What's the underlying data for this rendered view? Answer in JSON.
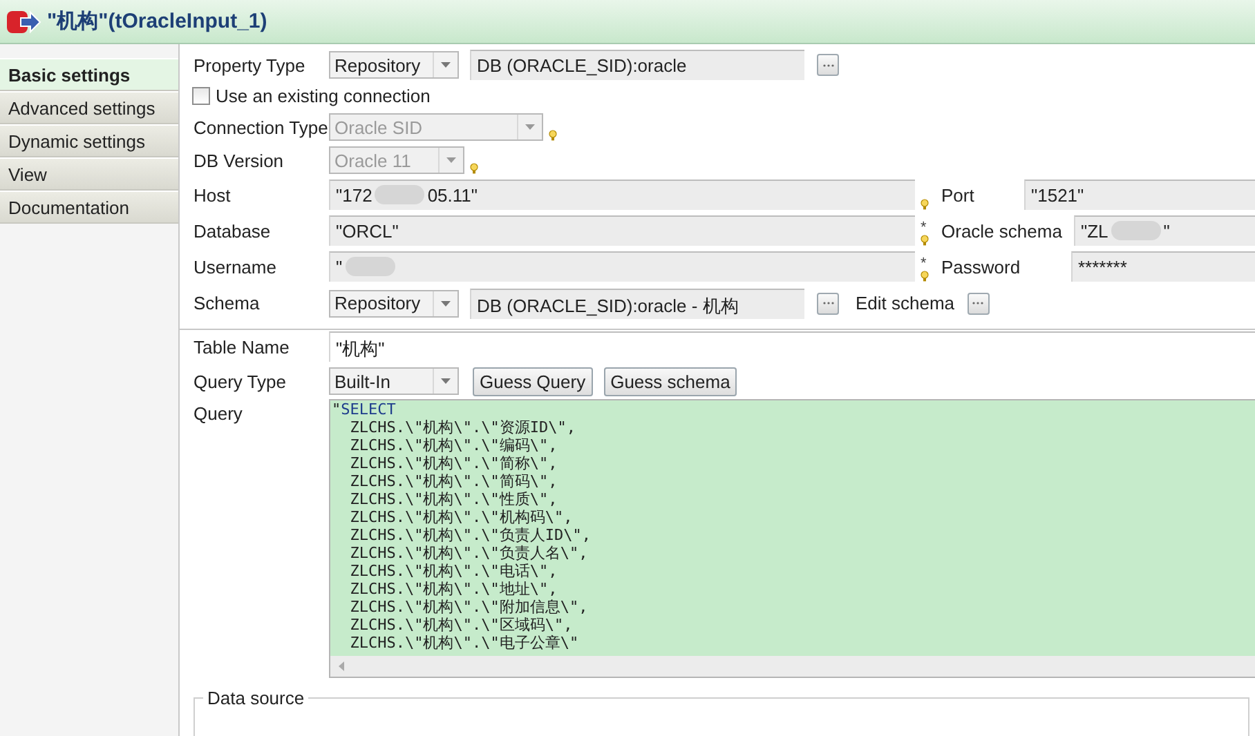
{
  "title": "\"机构\"(tOracleInput_1)",
  "sidebar": {
    "items": [
      {
        "label": "Basic settings",
        "selected": true
      },
      {
        "label": "Advanced settings",
        "selected": false
      },
      {
        "label": "Dynamic settings",
        "selected": false
      },
      {
        "label": "View",
        "selected": false
      },
      {
        "label": "Documentation",
        "selected": false
      }
    ]
  },
  "form": {
    "property_type": {
      "label": "Property Type",
      "value": "Repository",
      "repository": "DB (ORACLE_SID):oracle"
    },
    "use_existing_connection": {
      "label": "Use an existing connection",
      "checked": false
    },
    "connection_type": {
      "label": "Connection Type",
      "value": "Oracle SID",
      "disabled": true,
      "hint": true
    },
    "db_version": {
      "label": "DB Version",
      "value": "Oracle 11",
      "disabled": true,
      "hint": true
    },
    "host": {
      "label": "Host",
      "value_start": "\"172",
      "value_end": "05.11\"",
      "hint": true
    },
    "port": {
      "label": "Port",
      "value": "\"1521\""
    },
    "database": {
      "label": "Database",
      "value": "\"ORCL\"",
      "hint": true,
      "required_mark": "*"
    },
    "oracle_schema": {
      "label": "Oracle schema",
      "value_start": "\"ZL",
      "value_end": "\""
    },
    "username": {
      "label": "Username",
      "value_start": "\"",
      "hint": true,
      "required_mark": "*"
    },
    "password": {
      "label": "Password",
      "value": "*******"
    },
    "schema": {
      "label": "Schema",
      "value": "Repository",
      "repository": "DB (ORACLE_SID):oracle - 机构",
      "edit_label": "Edit schema"
    },
    "table_name": {
      "label": "Table Name",
      "value": "\"机构\""
    },
    "query_type": {
      "label": "Query Type",
      "value": "Built-In",
      "buttons": [
        "Guess Query",
        "Guess schema"
      ]
    },
    "query": {
      "label": "Query",
      "open_quote": "\"",
      "keyword": "SELECT",
      "lines": [
        "  ZLCHS.\\\"机构\\\".\\\"资源ID\\\",",
        "  ZLCHS.\\\"机构\\\".\\\"编码\\\",",
        "  ZLCHS.\\\"机构\\\".\\\"简称\\\",",
        "  ZLCHS.\\\"机构\\\".\\\"简码\\\",",
        "  ZLCHS.\\\"机构\\\".\\\"性质\\\",",
        "  ZLCHS.\\\"机构\\\".\\\"机构码\\\",",
        "  ZLCHS.\\\"机构\\\".\\\"负责人ID\\\",",
        "  ZLCHS.\\\"机构\\\".\\\"负责人名\\\",",
        "  ZLCHS.\\\"机构\\\".\\\"电话\\\",",
        "  ZLCHS.\\\"机构\\\".\\\"地址\\\",",
        "  ZLCHS.\\\"机构\\\".\\\"附加信息\\\",",
        "  ZLCHS.\\\"机构\\\".\\\"区域码\\\",",
        "  ZLCHS.\\\"机构\\\".\\\"电子公章\\\""
      ]
    }
  },
  "data_source": {
    "title": "Data source"
  }
}
